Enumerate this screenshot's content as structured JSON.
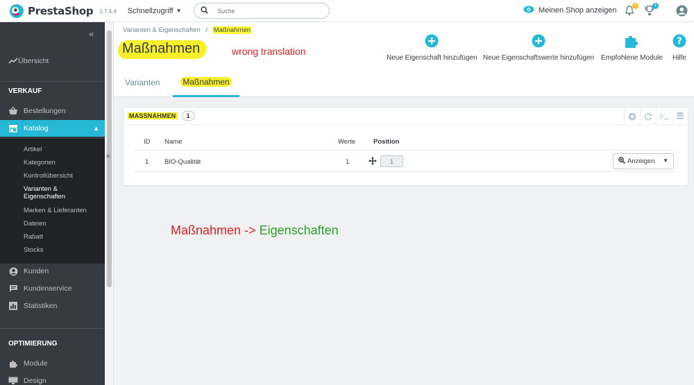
{
  "header": {
    "brand": "PrestaShop",
    "version": "1.7.4.4",
    "quick_access": "Schnellzugriff",
    "search_placeholder": "Suche",
    "view_shop": "Meinen Shop anzeigen",
    "notif_badge": "2",
    "trophy_badge": "1",
    "colors": {
      "accent": "#25b9d7",
      "notif": "#fbbb22",
      "trophy": "#25b9d7"
    }
  },
  "sidebar": {
    "overview": "Übersicht",
    "section_sales": "VERKAUF",
    "orders": "Bestellungen",
    "catalog": "Katalog",
    "catalog_sub": [
      "Artikel",
      "Kategorien",
      "Kontrollübersicht",
      "Varianten &",
      "Eigenschaften",
      "Marken & Lieferanten",
      "Dateien",
      "Rabatt",
      "Stocks"
    ],
    "customers": "Kunden",
    "service": "Kundenservice",
    "stats": "Statistiken",
    "section_opt": "OPTIMIERUNG",
    "modules": "Module",
    "design": "Design"
  },
  "page": {
    "breadcrumb_parent": "Varianten & Eigenschaften",
    "breadcrumb_sep": "/",
    "breadcrumb_current": "Maßnahmen",
    "title": "Maßnahmen",
    "annotation_wrong": "wrong translation",
    "toolbar": {
      "new_feature": "Neue Eigenschaft hinzufügen",
      "new_value": "Neue Eigenschaftswerte hinzufügen",
      "modules": "Empfohlene Module",
      "help": "Hilfe"
    },
    "tabs": [
      "Varianten",
      "Maßnahmen"
    ]
  },
  "panel": {
    "title": "MASSNAHMEN",
    "count": "1",
    "columns": [
      "ID",
      "Name",
      "Werte",
      "Position"
    ],
    "rows": [
      {
        "id": "1",
        "name": "BIO-Qualität",
        "values": "1",
        "position": "1",
        "action": "Anzeigen"
      }
    ]
  },
  "annotation": {
    "left": "Maßnahmen ->",
    "right": "Eigenschaften",
    "left_color": "#e02020",
    "right_color": "#2ca02c"
  }
}
